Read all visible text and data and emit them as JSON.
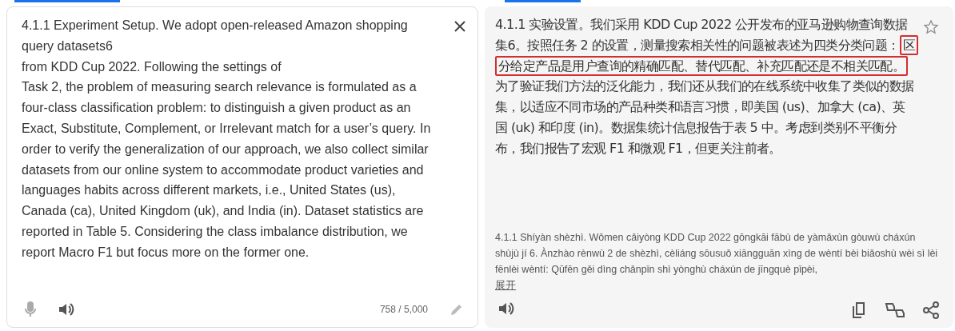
{
  "source": {
    "text": "4.1.1 Experiment Setup. We adopt open-released Amazon shopping query datasets6\nfrom KDD Cup 2022. Following the settings of\nTask 2, the problem of measuring search relevance is formulated as a four-class classification problem: to distinguish a given product as an Exact, Substitute, Complement, or Irrelevant match for a user’s query. In order to verify the generalization of our approach, we also collect similar datasets from our online system to accommodate product varieties and languages habits across different markets, i.e., United States (us), Canada (ca), United Kingdom (uk), and India (in). Dataset statistics are reported in Table 5. Considering the class imbalance distribution, we report Macro F1 but focus more on the former one.",
    "char_count": "758 / 5,000"
  },
  "target": {
    "segments": [
      {
        "text": "4.1.1 实验设置。我们采用 KDD Cup 2022 公开发布的亚马逊购物查询数据集6。按照任务 2 的设置，测量搜索相关性的问题被表述为四类分类问题：",
        "highlighted": false
      },
      {
        "text": "区分给定产品是用户查询的精确匹配、替代匹配、补充匹配还是不相关匹配。",
        "highlighted": true
      },
      {
        "text": "为了验证我们方法的泛化能力，我们还从我们的在线系统中收集了类似的数据集，以适应不同市场的产品种类和语言习惯，即美国 (us)、加拿大 (ca)、英国 (uk) 和印度 (in)。数据集统计信息报告于表 5 中。考虑到类别不平衡分布，我们报告了宏观 F1 和微观 F1，但更关注前者。",
        "highlighted": false
      }
    ],
    "romanization": "4.1.1 Shíyàn shèzhì. Wǒmen cǎiyòng KDD Cup 2022 gōngkāi fābù de yàmǎxùn gòuwù cháxún shùjù jí 6. Ànzhào rènwù 2 de shèzhì, cèliáng sōusuǒ xiāngguān xìng de wèntí bèi biǎoshù wèi sì lèi fēnlèi wèntí: Qūfēn gěi dìng chǎnpǐn shì yònghù cháxún de jīngquè pǐpèi,",
    "expand_link": "展开"
  }
}
